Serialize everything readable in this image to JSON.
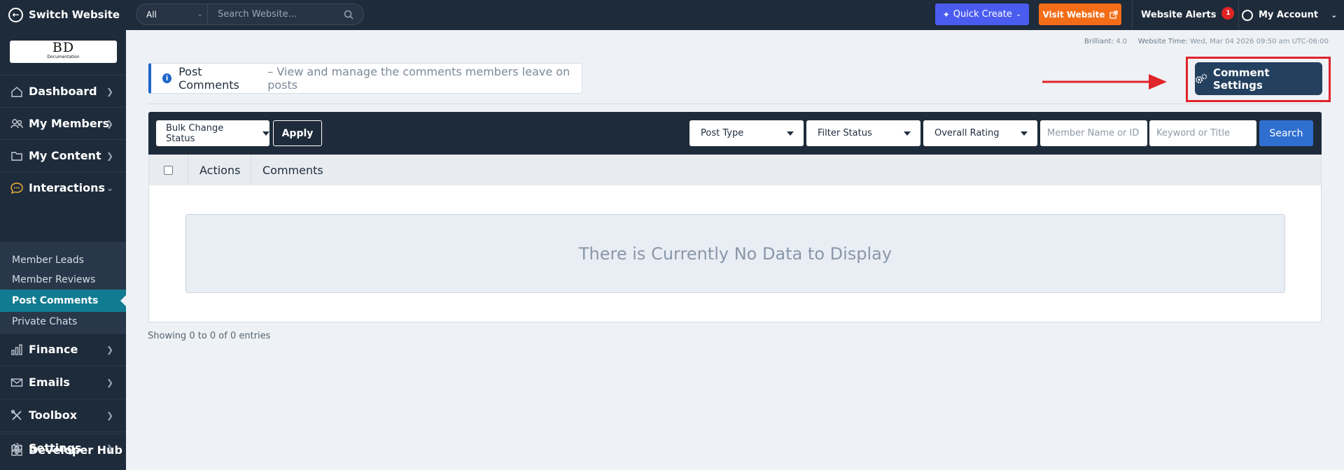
{
  "topbar": {
    "switch_label": "Switch Website",
    "search_scope": "All",
    "search_placeholder": "Search Website...",
    "quick_create": "Quick Create",
    "visit_website": "Visit Website",
    "alerts_label": "Website Alerts",
    "alerts_count": "1",
    "account_label": "My Account"
  },
  "sidebar": {
    "logo_main": "BD",
    "logo_sub": "Documentation",
    "items": [
      {
        "label": "Dashboard",
        "icon": "home-icon"
      },
      {
        "label": "My Members",
        "icon": "users-icon"
      },
      {
        "label": "My Content",
        "icon": "folder-icon"
      },
      {
        "label": "Interactions",
        "icon": "chat-icon"
      },
      {
        "label": "Finance",
        "icon": "bar-chart-icon"
      },
      {
        "label": "Emails",
        "icon": "email-icon"
      },
      {
        "label": "Toolbox",
        "icon": "tools-icon"
      },
      {
        "label": "Settings",
        "icon": "gear-icon"
      },
      {
        "label": "Developer Hub",
        "icon": "grid-icon"
      }
    ],
    "sub_items": [
      "Member Leads",
      "Member Reviews",
      "Post Comments",
      "Private Chats"
    ],
    "active_sub": "Post Comments"
  },
  "meta": {
    "version_label": "Brilliant:",
    "version": "4.0",
    "time_label": "Website Time:",
    "time": "Wed, Mar 04 2026 09:50 am UTC-06:00"
  },
  "header": {
    "title": "Post Comments",
    "description": "– View and manage the comments members leave on posts"
  },
  "comment_settings": "Comment Settings",
  "filters": {
    "bulk": "Bulk Change Status",
    "apply": "Apply",
    "post_type": "Post Type",
    "filter_status": "Filter Status",
    "overall_rating": "Overall Rating",
    "member_placeholder": "Member Name or ID",
    "keyword_placeholder": "Keyword or Title",
    "search": "Search"
  },
  "table": {
    "columns": [
      "Actions",
      "Comments"
    ],
    "empty_message": "There is Currently No Data to Display",
    "showing": "Showing 0 to 0 of 0 entries"
  },
  "colors": {
    "sidebar_bg": "#1e2b3a",
    "active_teal": "#117b91",
    "quick_create": "#4a5cf0",
    "visit_orange": "#f36c17",
    "highlight_red": "#e0242b",
    "search_blue": "#2f6fd0"
  }
}
